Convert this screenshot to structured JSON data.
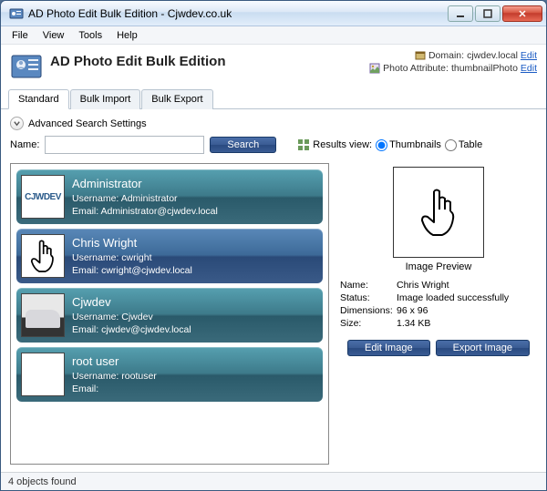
{
  "window": {
    "title": "AD Photo Edit Bulk Edition - Cjwdev.co.uk"
  },
  "menu": {
    "file": "File",
    "view": "View",
    "tools": "Tools",
    "help": "Help"
  },
  "header": {
    "title": "AD Photo Edit Bulk Edition",
    "domain_label": "Domain:",
    "domain_value": "cjwdev.local",
    "photo_attr_label": "Photo Attribute:",
    "photo_attr_value": "thumbnailPhoto",
    "edit": "Edit"
  },
  "tabs": {
    "standard": "Standard",
    "bulk_import": "Bulk Import",
    "bulk_export": "Bulk Export"
  },
  "adv": "Advanced Search Settings",
  "search": {
    "name_label": "Name:",
    "value": "",
    "button": "Search",
    "results_view": "Results view:",
    "thumbnails": "Thumbnails",
    "table": "Table"
  },
  "users": [
    {
      "display": "Administrator",
      "username_label": "Username:",
      "username": "Administrator",
      "email_label": "Email:",
      "email": "Administrator@cjwdev.local",
      "thumb": "cjwdev"
    },
    {
      "display": "Chris Wright",
      "username_label": "Username:",
      "username": "cwright",
      "email_label": "Email:",
      "email": "cwright@cjwdev.local",
      "thumb": "cursor",
      "selected": true
    },
    {
      "display": "Cjwdev",
      "username_label": "Username:",
      "username": "Cjwdev",
      "email_label": "Email:",
      "email": "cjwdev@cjwdev.local",
      "thumb": "car"
    },
    {
      "display": "root user",
      "username_label": "Username:",
      "username": "rootuser",
      "email_label": "Email:",
      "email": "",
      "thumb": "blank"
    }
  ],
  "detail": {
    "preview_label": "Image Preview",
    "name_label": "Name:",
    "name_value": "Chris Wright",
    "status_label": "Status:",
    "status_value": "Image loaded successfully",
    "dim_label": "Dimensions:",
    "dim_value": "96 x 96",
    "size_label": "Size:",
    "size_value": "1.34 KB",
    "edit_image": "Edit Image",
    "export_image": "Export Image"
  },
  "status": "4 objects found"
}
